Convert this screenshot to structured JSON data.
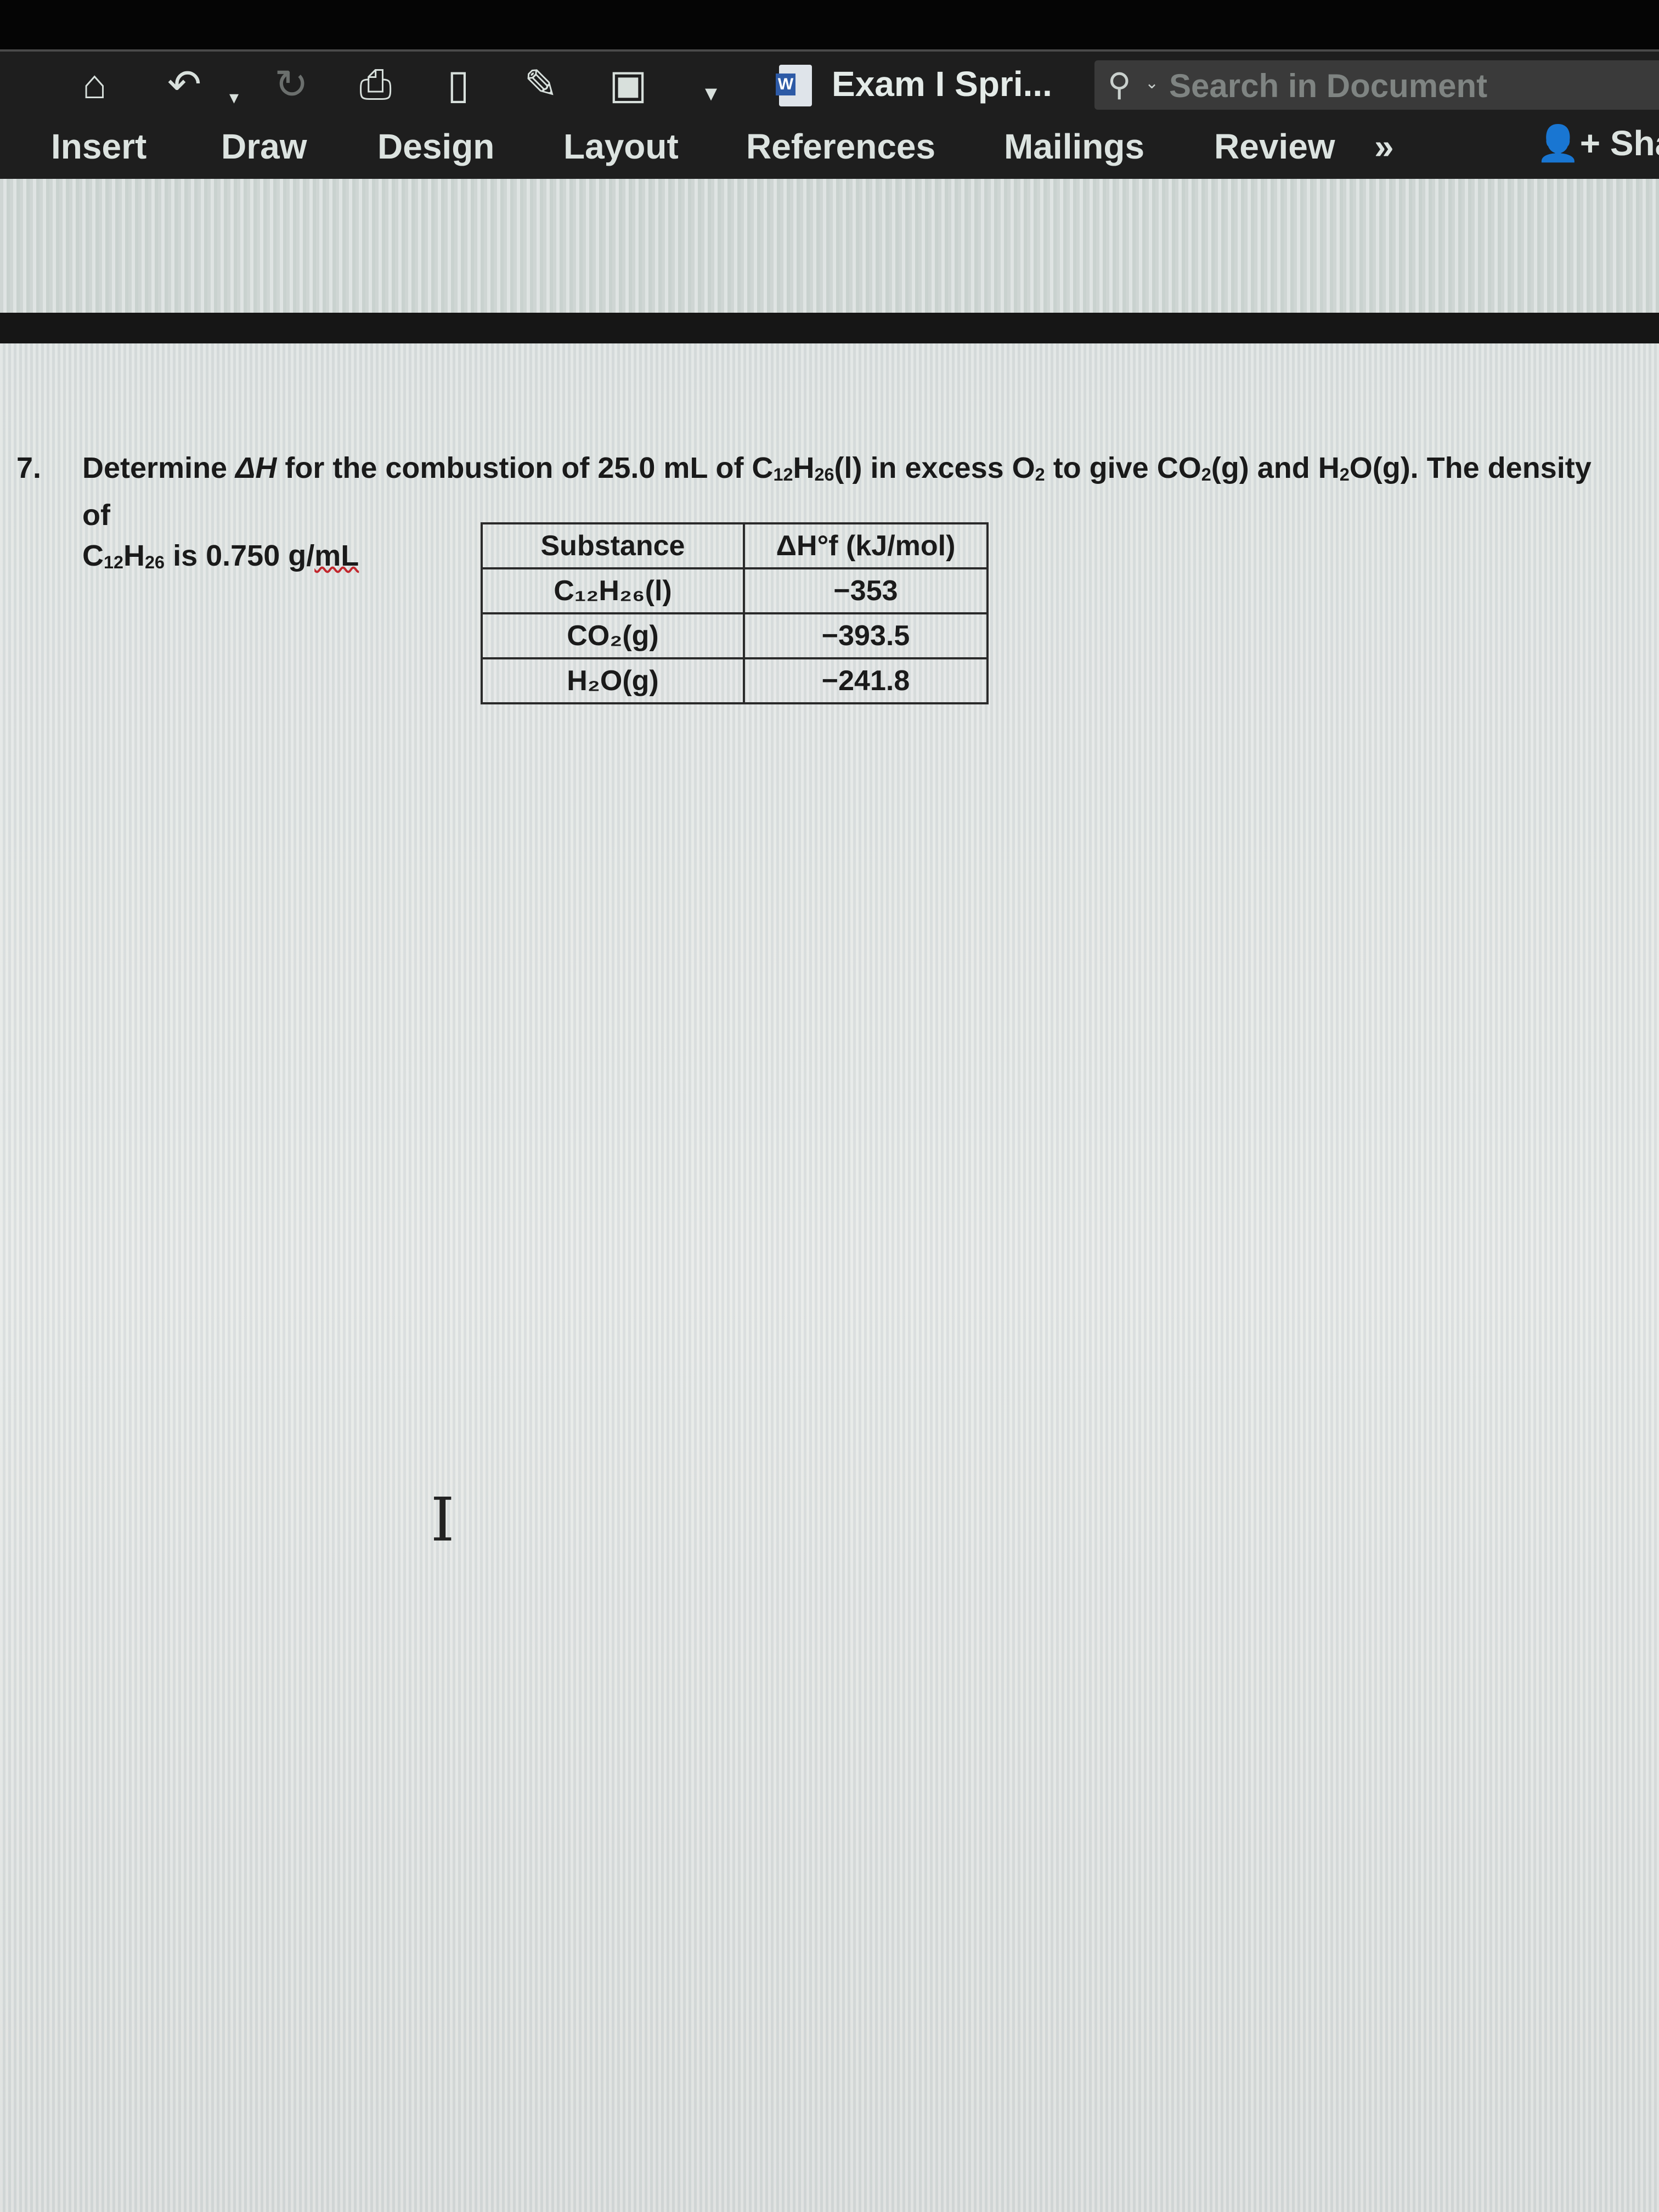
{
  "toolbar": {
    "quick_access": [
      {
        "name": "home-icon",
        "glyph": "⌂"
      },
      {
        "name": "undo-icon",
        "glyph": "↶"
      },
      {
        "name": "undo-dropdown-icon",
        "glyph": "▾"
      },
      {
        "name": "redo-icon",
        "glyph": "↻"
      },
      {
        "name": "print-icon",
        "glyph": "⎙"
      },
      {
        "name": "new-document-icon",
        "glyph": "🗋"
      },
      {
        "name": "edit-document-icon",
        "glyph": "✎"
      },
      {
        "name": "save-icon",
        "glyph": "💾"
      },
      {
        "name": "customize-toolbar-icon",
        "glyph": "▾"
      }
    ],
    "document_title": "Exam I Spri...",
    "app_icon_letter": "W",
    "search": {
      "placeholder": "Search in Document",
      "value": ""
    },
    "tabs": [
      "Insert",
      "Draw",
      "Design",
      "Layout",
      "References",
      "Mailings",
      "Review"
    ],
    "more_tabs_label": "»",
    "share_label": "Sha"
  },
  "document": {
    "question_number": "7.",
    "question_text_parts": {
      "p1": "Determine ",
      "delta_h": "ΔH",
      "p2": " for the combustion of 25.0 mL of C",
      "sub12": "12",
      "h": "H",
      "sub26": "26",
      "p3": "(l) in excess O",
      "sub2a": "2",
      "p4": " to give CO",
      "sub2b": "2",
      "p5": "(g) and H",
      "sub2c": "2",
      "p6": "O(g). The density of",
      "line2_c": "C",
      "line2_sub12": "12",
      "line2_h": "H",
      "line2_sub26": "26",
      "line2_rest": " is 0.750 g/",
      "line2_unit": "mL"
    },
    "table": {
      "headers": [
        "Substance",
        "ΔH°f (kJ/mol)"
      ],
      "rows": [
        {
          "substance": "C₁₂H₂₆(l)",
          "value": "−353"
        },
        {
          "substance": "CO₂(g)",
          "value": "−393.5"
        },
        {
          "substance": "H₂O(g)",
          "value": "−241.8"
        }
      ]
    },
    "cursor": "I"
  }
}
